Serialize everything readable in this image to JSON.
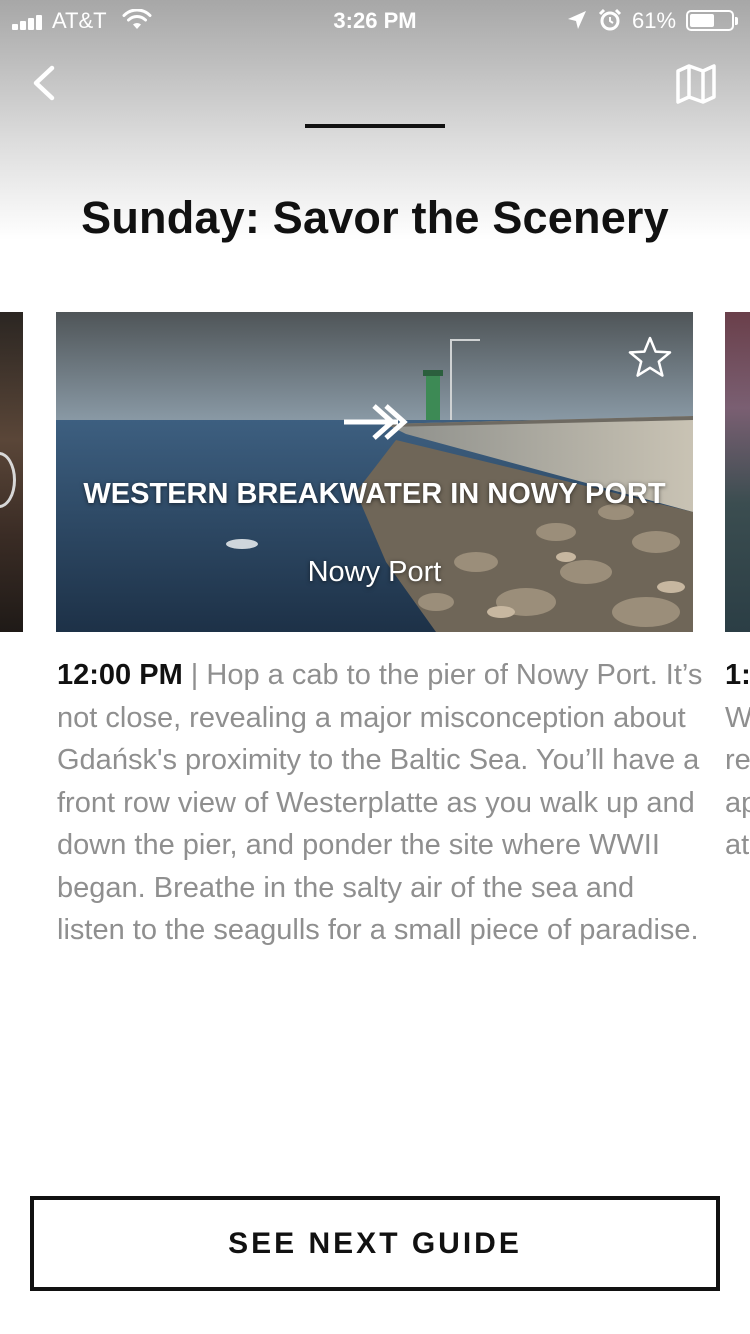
{
  "status_bar": {
    "carrier": "AT&T",
    "time": "3:26 PM",
    "battery_percent": "61%",
    "battery_level": 0.61,
    "icons": [
      "signal-icon",
      "wifi-icon",
      "location-arrow-icon",
      "alarm-icon",
      "battery-icon"
    ]
  },
  "nav": {
    "back_icon": "chevron-left-icon",
    "map_icon": "map-icon"
  },
  "page": {
    "title": "Sunday: Savor the Scenery"
  },
  "card": {
    "name": "WESTERN BREAKWATER IN NOWY PORT",
    "subtitle": "Nowy Port",
    "star_icon": "star-outline-icon",
    "arrow_icon": "double-arrow-right-icon"
  },
  "description": {
    "time": "12:00 PM",
    "separator": "|",
    "text": "Hop a cab to the pier of Nowy Port. It’s not close, revealing a major misconception about Gdańsk's proximity to the Baltic Sea. You’ll have a front row view of Westerplatte as you walk up and down the pier, and ponder the site where WWII began. Breathe in the salty air of the sea and listen to the seagulls for a small piece of paradise."
  },
  "next_card_peek": {
    "time_fragment": "1:",
    "lines": [
      "W",
      "re",
      "ap",
      "at"
    ]
  },
  "cta": {
    "label": "SEE NEXT GUIDE"
  }
}
